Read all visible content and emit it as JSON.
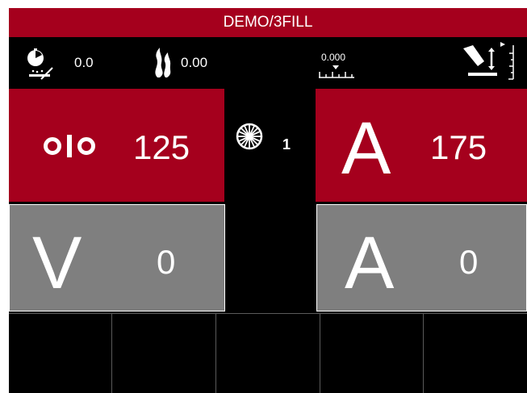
{
  "title": "DEMO/3FILL",
  "status": {
    "wire_timer": {
      "icon": "wire-burnback-timer-icon",
      "value": "0.0"
    },
    "gas": {
      "icon": "gas-flow-icon",
      "value": "0.00"
    },
    "scale": {
      "icon": "scale-ruler-icon",
      "value": "0.000"
    },
    "torch_height": {
      "icon": "torch-height-icon"
    }
  },
  "panels": {
    "wire_speed": {
      "icon": "wire-feed-icon",
      "value": "125"
    },
    "current_set": {
      "letter": "A",
      "value": "175"
    },
    "voltage_meas": {
      "letter": "V",
      "value": "0"
    },
    "current_meas": {
      "letter": "A",
      "value": "0"
    }
  },
  "program": {
    "icon": "wire-spool-icon",
    "number": "1"
  },
  "bottom_buttons": [
    "",
    "",
    "",
    "",
    ""
  ],
  "colors": {
    "accent": "#a5001d",
    "panel_grey": "#7f7f7f",
    "background": "#000000"
  }
}
